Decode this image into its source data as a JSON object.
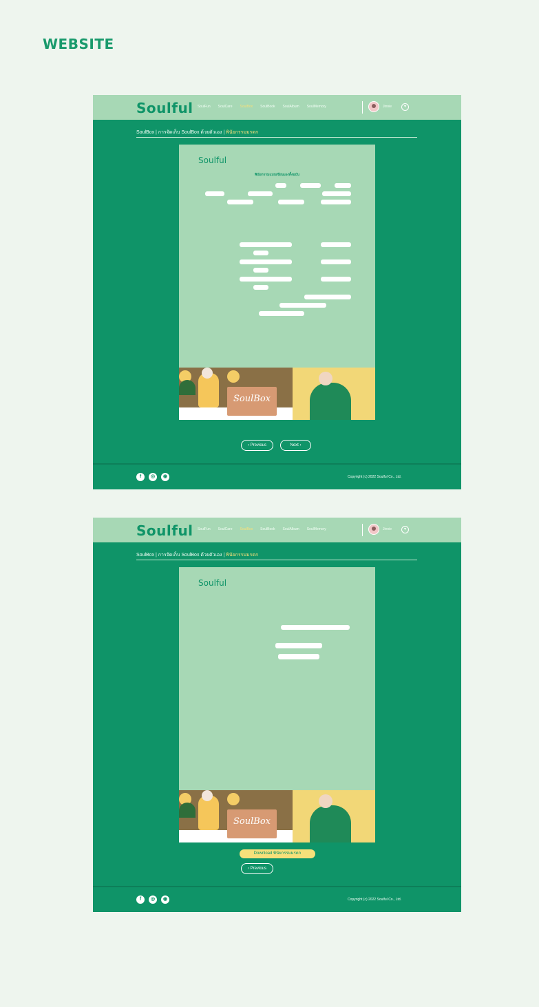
{
  "page": {
    "title": "WEBSITE"
  },
  "mockups": [
    {
      "nav": {
        "logo": "Soulful",
        "links": [
          "SoulFun",
          "SoulCare",
          "SoulBox",
          "SoulBook",
          "SoulAlbum",
          "SoulMemory"
        ],
        "active_index": 2,
        "user": "Jinnie"
      },
      "breadcrumb": {
        "path": "SoulBox | การจัดเก็บ SoulBox ด้วยตัวเอง | ",
        "current": "พินัยกรรมมรดก"
      },
      "paper": {
        "logo": "Soulful",
        "title": "พินัยกรรมแบบเขียนเองทั้งฉบับ"
      },
      "buttons": {
        "previous": "‹ Previous",
        "next": "Next ›"
      },
      "footer": {
        "copyright": "Copyright (c) 2022 Soulful Co., Ltd."
      }
    },
    {
      "nav": {
        "logo": "Soulful",
        "links": [
          "SoulFun",
          "SoulCare",
          "SoulBox",
          "SoulBook",
          "SoulAlbum",
          "SoulMemory"
        ],
        "active_index": 2,
        "user": "Jinnie"
      },
      "breadcrumb": {
        "path": "SoulBox | การจัดเก็บ SoulBox ด้วยตัวเอง | ",
        "current": "พินัยกรรมมรดก"
      },
      "paper": {
        "logo": "Soulful"
      },
      "buttons": {
        "download": "Download พินัยกรรมมรดก",
        "previous": "‹ Previous"
      },
      "footer": {
        "copyright": "Copyright (c) 2022 Soulful Co., Ltd."
      }
    }
  ],
  "art": {
    "box_label": "SoulBox"
  },
  "icons": [
    "facebook-icon",
    "instagram-icon",
    "line-icon",
    "avatar",
    "dropdown-icon"
  ],
  "colors": {
    "primary": "#0f9468",
    "light": "#a7d8b5",
    "accent": "#f7e07a",
    "background": "#eef5ee"
  }
}
